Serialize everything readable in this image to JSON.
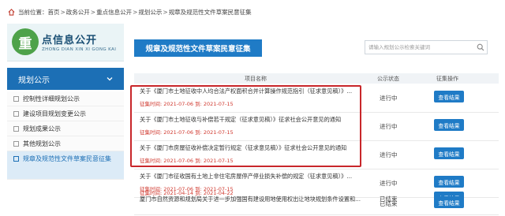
{
  "breadcrumb": {
    "label": "当前位置：",
    "items": [
      "首页",
      "政务公开",
      "重点信息公开",
      "规划公示",
      "规章及规范性文件草案民意征集"
    ]
  },
  "brand": {
    "logo_char": "重",
    "title": "点信息公开",
    "subtitle": "ZHONG DIAN XIN XI GONG KAI"
  },
  "sidebar": {
    "section_title": "规划公示",
    "items": [
      {
        "label": "控制性详细规划公示"
      },
      {
        "label": "建设项目规划变更公示"
      },
      {
        "label": "规划成果公示"
      },
      {
        "label": "其他规划公示"
      },
      {
        "label": "规章及规范性文件草案民意征集"
      }
    ]
  },
  "main": {
    "title": "规章及规范性文件草案民意征集",
    "search_placeholder": "请输入规划公示检索关键词",
    "columns": {
      "name": "项目名称",
      "status": "公示状态",
      "action": "征集操作"
    },
    "rows": [
      {
        "name": "关于《厦门市土地征收中人均合法产权面积合并计算操作规范指引（征求意见稿）》...",
        "dates": "征集时间: 2021-07-06 到: 2021-07-15",
        "status": "进行中",
        "action": "查看结果"
      },
      {
        "name": "关于《厦门市土地征收与补偿若干规定（征求意见稿）》征求社会公开意见的通知",
        "dates": "征集时间: 2021-07-06 到: 2021-07-15",
        "status": "进行中",
        "action": "查看结果"
      },
      {
        "name": "关于《厦门市房屋征收补偿决定暂行规定（征求意见稿）》征求社会公开意见的通知",
        "dates": "征集时间: 2021-07-06 到: 2021-07-15",
        "status": "进行中",
        "action": "查看结果"
      },
      {
        "name": "关于《厦门市征收国有土地上非住宅房屋停产停业损失补偿的规定（征求意见稿）》...",
        "dates": "征集时间: 2021-07-06 到: 2021-07-15",
        "status": "进行中",
        "action": "查看结果"
      },
      {
        "name": "",
        "dates": "征集时间: 2021-04-14 到: 2021-04-22",
        "status": "已结束",
        "action": "查看结果"
      },
      {
        "name": "厦门市自然资源和规划局关于进一步加强国有建设用地使用权出让地块规划条件设置和...",
        "dates": "",
        "status": "已结束",
        "action": "查看结果"
      }
    ]
  },
  "colors": {
    "accent": "#1f7bc6",
    "highlight": "#c8262a",
    "date_red": "#d0392f",
    "logo_green": "#4ea24a"
  }
}
